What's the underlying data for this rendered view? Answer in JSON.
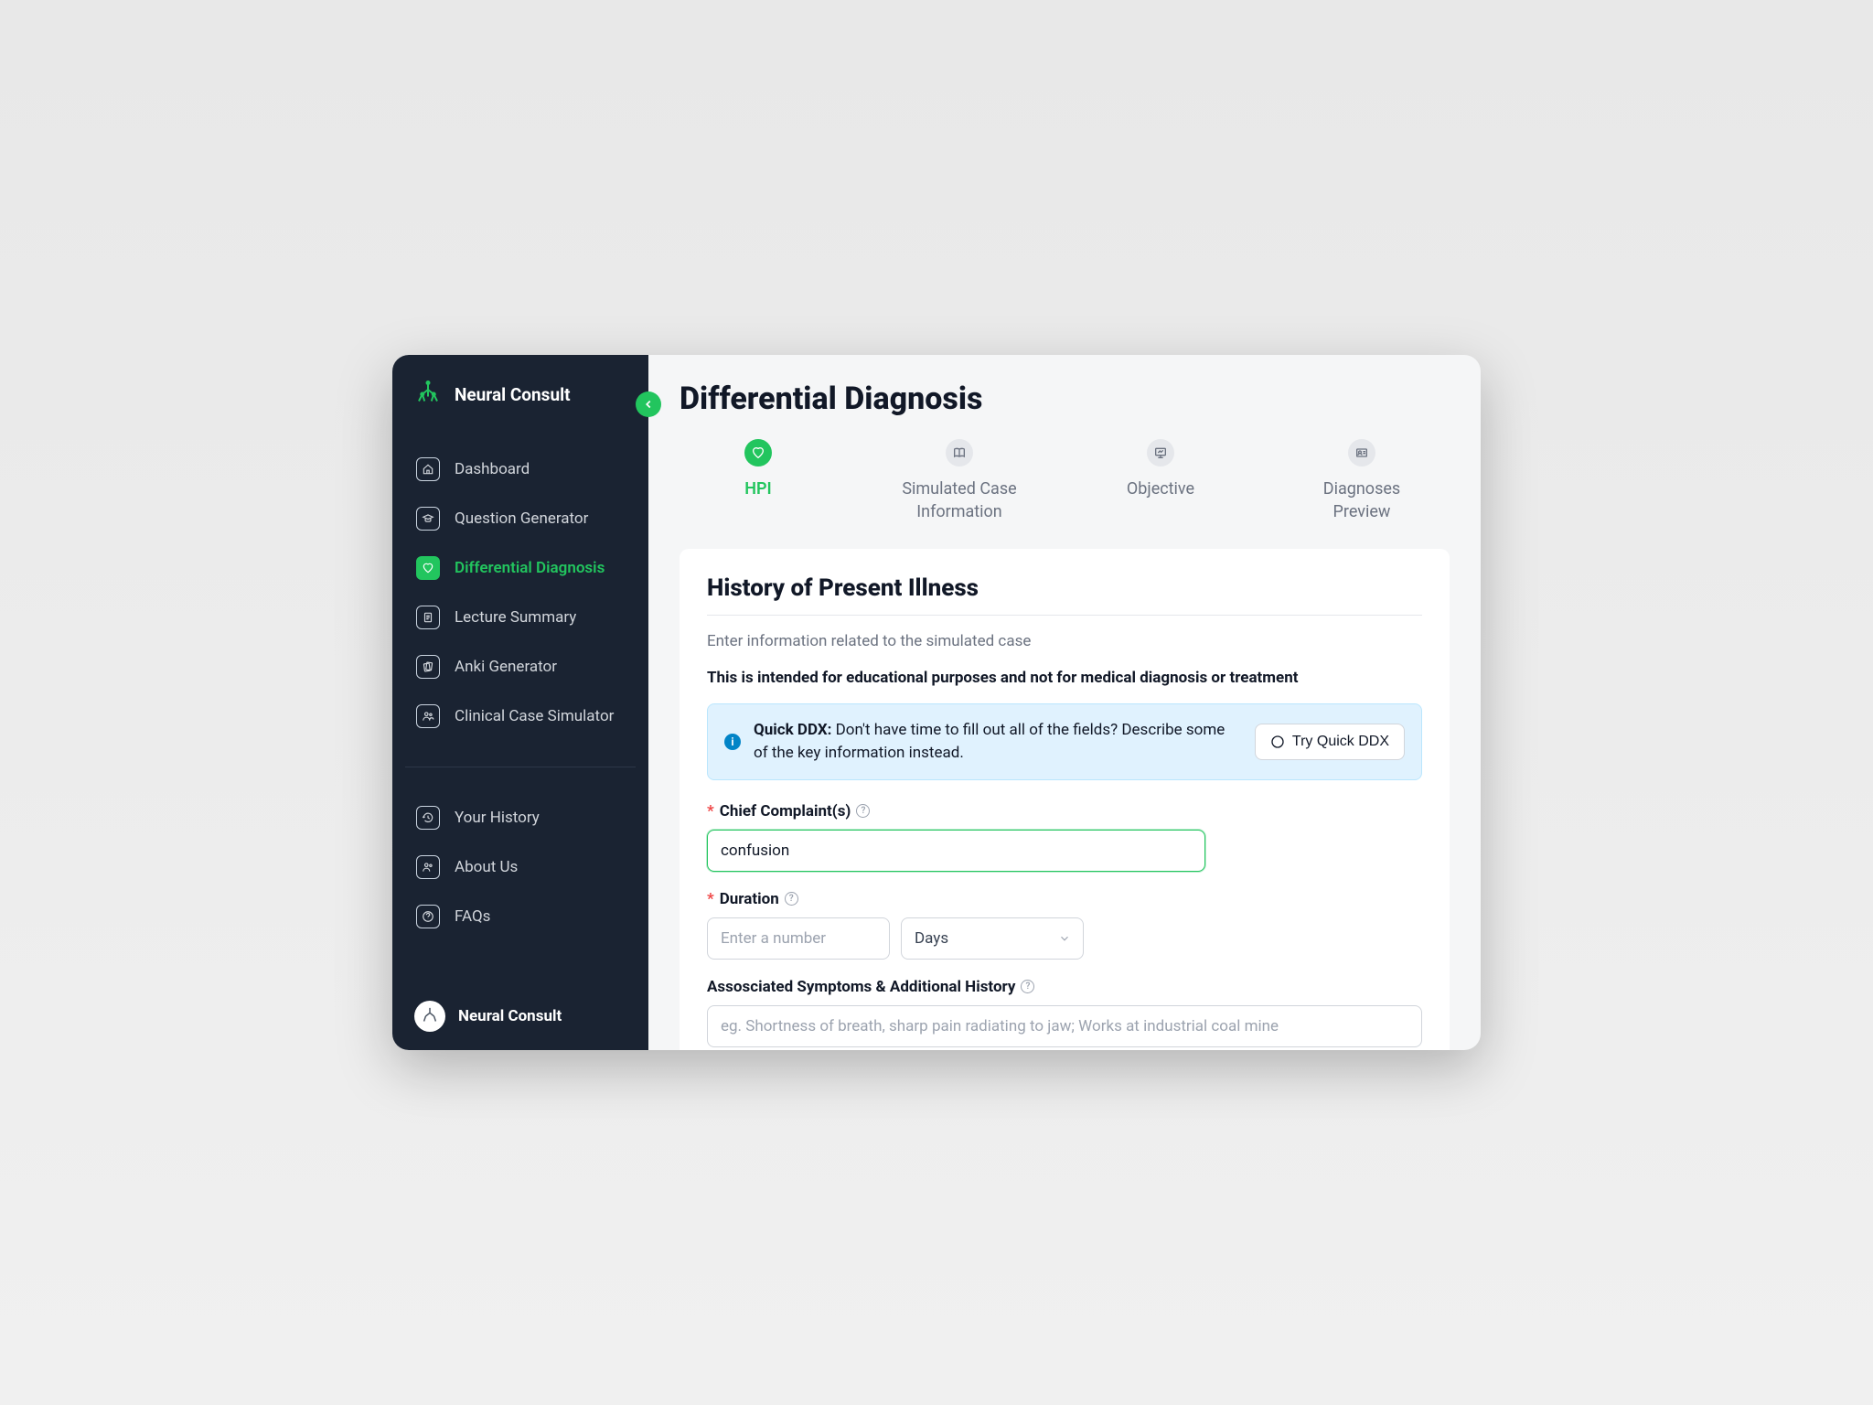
{
  "brand": {
    "name": "Neural Consult"
  },
  "sidebar": {
    "items": [
      {
        "label": "Dashboard"
      },
      {
        "label": "Question Generator"
      },
      {
        "label": "Differential Diagnosis"
      },
      {
        "label": "Lecture Summary"
      },
      {
        "label": "Anki Generator"
      },
      {
        "label": "Clinical Case Simulator"
      }
    ],
    "secondary": [
      {
        "label": "Your History"
      },
      {
        "label": "About Us"
      },
      {
        "label": "FAQs"
      }
    ]
  },
  "footer_user": "Neural Consult",
  "page": {
    "title": "Differential Diagnosis",
    "steps": [
      {
        "label": "HPI"
      },
      {
        "label": "Simulated Case Information"
      },
      {
        "label": "Objective"
      },
      {
        "label": "Diagnoses Preview"
      }
    ]
  },
  "card": {
    "title": "History of Present Illness",
    "subtitle": "Enter information related to the simulated case",
    "notice": "This is intended for educational purposes and not for medical diagnosis or treatment",
    "alert": {
      "headline": "Quick DDX:",
      "body": "Don't have time to fill out all of the fields? Describe some of the key information instead.",
      "button": "Try Quick DDX"
    },
    "fields": {
      "chief_complaint": {
        "label": "Chief Complaint(s)",
        "value": "confusion",
        "required": true
      },
      "duration": {
        "label": "Duration",
        "placeholder": "Enter a number",
        "unit": "Days",
        "required": true
      },
      "associated": {
        "label": "Assosciated Symptoms & Additional History",
        "placeholder": "eg. Shortness of breath, sharp pain radiating to jaw; Works at industrial coal mine"
      }
    }
  }
}
